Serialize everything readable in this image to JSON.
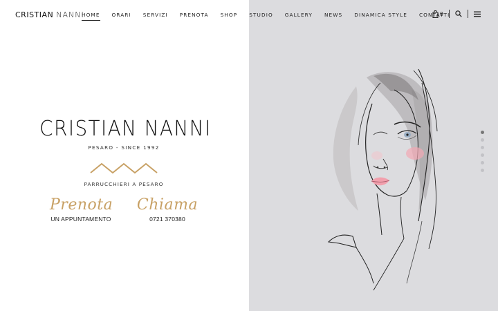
{
  "header": {
    "logo_first": "CRISTIAN",
    "logo_last": "NANNI",
    "nav": [
      {
        "label": "HOME",
        "active": true
      },
      {
        "label": "ORARI",
        "active": false
      },
      {
        "label": "SERVIZI",
        "active": false
      },
      {
        "label": "PRENOTA",
        "active": false
      },
      {
        "label": "SHOP",
        "active": false
      },
      {
        "label": "STUDIO",
        "active": false
      },
      {
        "label": "GALLERY",
        "active": false
      },
      {
        "label": "NEWS",
        "active": false
      },
      {
        "label": "DINAMICA STYLE",
        "active": false
      },
      {
        "label": "CONTATTI",
        "active": false
      }
    ],
    "cart_count": "0",
    "cart_icon": "bag-icon",
    "search_icon": "search-icon",
    "menu_icon": "hamburger-icon"
  },
  "hero": {
    "brand_name": "CRISTIAN NANNI",
    "brand_sub": "PESARO - SINCE 1992",
    "tagline": "PARRUCCHIERI A PESARO",
    "prenota_script": "Prenota",
    "prenota_label": "UN APPUNTAMENTO",
    "chiama_script": "Chiama",
    "chiama_label": "0721 370380"
  },
  "slider": {
    "total": 6,
    "active_index": 0
  },
  "colors": {
    "accent_gold": "#c8a165",
    "panel_gray": "#dcdcdf",
    "text": "#111111"
  }
}
